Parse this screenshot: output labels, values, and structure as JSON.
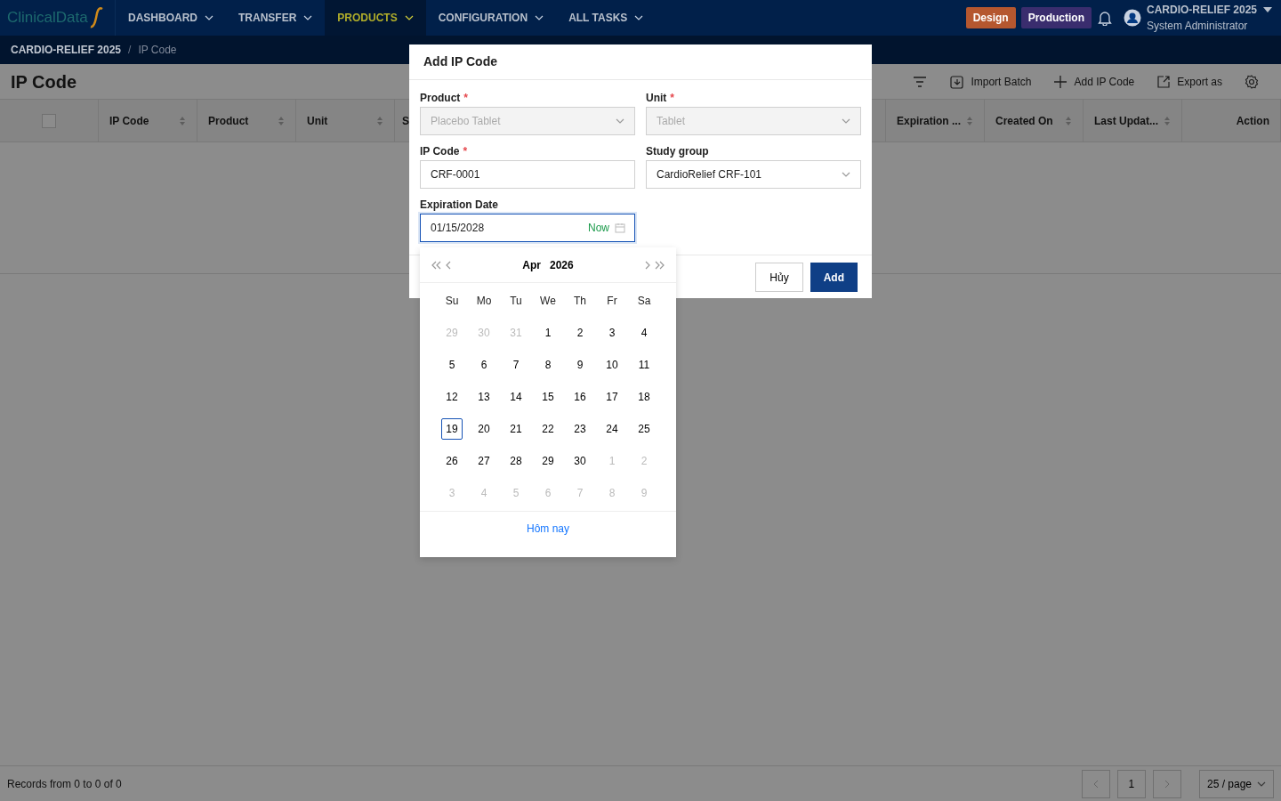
{
  "header": {
    "logo": "ClinicalData",
    "nav": [
      {
        "label": "DASHBOARD",
        "selected": false
      },
      {
        "label": "TRANSFER",
        "selected": false
      },
      {
        "label": "PRODUCTS",
        "selected": true
      },
      {
        "label": "CONFIGURATION",
        "selected": false
      },
      {
        "label": "ALL TASKS",
        "selected": false
      }
    ],
    "badges": [
      {
        "label": "Design",
        "color": "#b5572f"
      },
      {
        "label": "Production",
        "color": "#3a2d6e"
      }
    ],
    "user": {
      "study": "CARDIO-RELIEF 2025",
      "role": "System Administrator"
    }
  },
  "breadcrumb": {
    "separator": "/",
    "items": [
      "CARDIO-RELIEF 2025",
      "IP Code"
    ]
  },
  "page": {
    "title": "IP Code",
    "actions": [
      {
        "kind": "filter"
      },
      {
        "kind": "import",
        "label": "Import Batch"
      },
      {
        "kind": "add",
        "label": "Add IP Code"
      },
      {
        "kind": "export",
        "label": "Export as"
      },
      {
        "kind": "settings"
      }
    ]
  },
  "table": {
    "columns": [
      {
        "kind": "checkbox",
        "checked": false
      },
      {
        "label": "IP Code",
        "kind": "sort"
      },
      {
        "label": "Product",
        "kind": "sort"
      },
      {
        "label": "Unit",
        "kind": "sort"
      },
      {
        "label": "S",
        "kind": "cut"
      },
      {
        "label": "Expiration ...",
        "kind": "sort"
      },
      {
        "label": "Created On",
        "kind": "sort"
      },
      {
        "label": "Last Updat...",
        "kind": "sort"
      },
      {
        "label": "Action",
        "kind": "plain"
      }
    ]
  },
  "footer": {
    "records": "Records from 0 to 0 of 0",
    "page": "1",
    "page_size": "25 / page"
  },
  "dialog": {
    "title": "Add IP Code",
    "required_mark": "*",
    "fields": [
      {
        "label": "Product",
        "required": true,
        "kind": "select",
        "value": "Placebo Tablet",
        "disabled": true
      },
      {
        "label": "Unit",
        "required": true,
        "kind": "select",
        "value": "Tablet",
        "disabled": true
      },
      {
        "label": "IP Code",
        "required": true,
        "kind": "text",
        "value": "CRF-0001",
        "disabled": false
      },
      {
        "label": "Study group",
        "required": false,
        "kind": "select",
        "value": "CardioRelief CRF-101",
        "disabled": false
      },
      {
        "label": "Expiration Date",
        "required": false,
        "kind": "date",
        "value": "01/15/2028",
        "now": "Now",
        "disabled": false
      }
    ],
    "buttons": [
      {
        "label": "Hủy",
        "kind": "secondary"
      },
      {
        "label": "Add",
        "kind": "primary"
      }
    ]
  },
  "calendar": {
    "month": "Apr",
    "year": "2026",
    "weekdays": [
      "Su",
      "Mo",
      "Tu",
      "We",
      "Th",
      "Fr",
      "Sa"
    ],
    "weeks": [
      [
        {
          "d": "29",
          "in_month": false,
          "today": false
        },
        {
          "d": "30",
          "in_month": false,
          "today": false
        },
        {
          "d": "31",
          "in_month": false,
          "today": false
        },
        {
          "d": "1",
          "in_month": true,
          "today": false
        },
        {
          "d": "2",
          "in_month": true,
          "today": false
        },
        {
          "d": "3",
          "in_month": true,
          "today": false
        },
        {
          "d": "4",
          "in_month": true,
          "today": false
        }
      ],
      [
        {
          "d": "5",
          "in_month": true,
          "today": false
        },
        {
          "d": "6",
          "in_month": true,
          "today": false
        },
        {
          "d": "7",
          "in_month": true,
          "today": false
        },
        {
          "d": "8",
          "in_month": true,
          "today": false
        },
        {
          "d": "9",
          "in_month": true,
          "today": false
        },
        {
          "d": "10",
          "in_month": true,
          "today": false
        },
        {
          "d": "11",
          "in_month": true,
          "today": false
        }
      ],
      [
        {
          "d": "12",
          "in_month": true,
          "today": false
        },
        {
          "d": "13",
          "in_month": true,
          "today": false
        },
        {
          "d": "14",
          "in_month": true,
          "today": false
        },
        {
          "d": "15",
          "in_month": true,
          "today": false
        },
        {
          "d": "16",
          "in_month": true,
          "today": false
        },
        {
          "d": "17",
          "in_month": true,
          "today": false
        },
        {
          "d": "18",
          "in_month": true,
          "today": false
        }
      ],
      [
        {
          "d": "19",
          "in_month": true,
          "today": true
        },
        {
          "d": "20",
          "in_month": true,
          "today": false
        },
        {
          "d": "21",
          "in_month": true,
          "today": false
        },
        {
          "d": "22",
          "in_month": true,
          "today": false
        },
        {
          "d": "23",
          "in_month": true,
          "today": false
        },
        {
          "d": "24",
          "in_month": true,
          "today": false
        },
        {
          "d": "25",
          "in_month": true,
          "today": false
        }
      ],
      [
        {
          "d": "26",
          "in_month": true,
          "today": false
        },
        {
          "d": "27",
          "in_month": true,
          "today": false
        },
        {
          "d": "28",
          "in_month": true,
          "today": false
        },
        {
          "d": "29",
          "in_month": true,
          "today": false
        },
        {
          "d": "30",
          "in_month": true,
          "today": false
        },
        {
          "d": "1",
          "in_month": false,
          "today": false
        },
        {
          "d": "2",
          "in_month": false,
          "today": false
        }
      ],
      [
        {
          "d": "3",
          "in_month": false,
          "today": false
        },
        {
          "d": "4",
          "in_month": false,
          "today": false
        },
        {
          "d": "5",
          "in_month": false,
          "today": false
        },
        {
          "d": "6",
          "in_month": false,
          "today": false
        },
        {
          "d": "7",
          "in_month": false,
          "today": false
        },
        {
          "d": "8",
          "in_month": false,
          "today": false
        },
        {
          "d": "9",
          "in_month": false,
          "today": false
        }
      ]
    ],
    "today_link": "Hôm nay"
  }
}
